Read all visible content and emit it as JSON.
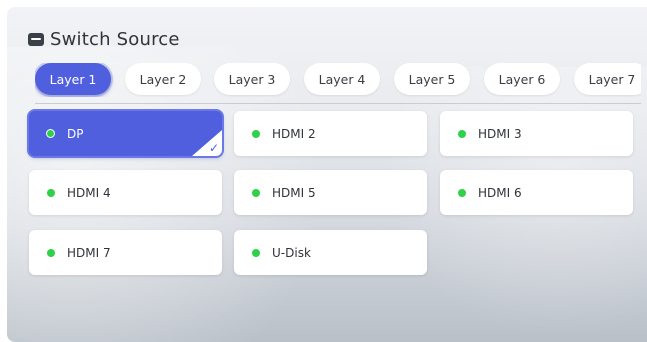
{
  "title": "Switch Source",
  "layers": [
    "Layer 1",
    "Layer 2",
    "Layer 3",
    "Layer 4",
    "Layer 5",
    "Layer 6",
    "Layer 7"
  ],
  "active_layer": "Layer 1",
  "sources": [
    "DP",
    "HDMI 2",
    "HDMI 3",
    "HDMI 4",
    "HDMI 5",
    "HDMI 6",
    "HDMI 7",
    "U-Disk"
  ],
  "selected_source": "DP",
  "colors": {
    "accent": "#4f5fde",
    "status_dot": "#2fd14a",
    "title": "#2f333a"
  }
}
